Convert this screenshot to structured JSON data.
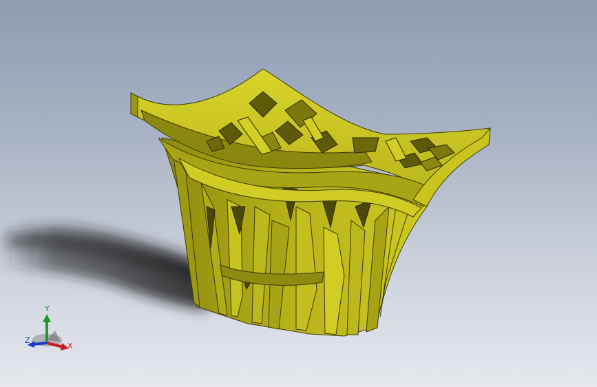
{
  "viewport": {
    "background_top": "#8d9cb2",
    "background_bottom": "#e6e8ee",
    "model_color": "#c9c41a",
    "model_shade": "#a7a214",
    "model_dark": "#6e6b0c"
  },
  "triad": {
    "x_label": "X",
    "y_label": "Y",
    "z_label": "Z",
    "x_color": "#c81e1e",
    "y_color": "#1e9a32",
    "z_color": "#1e3cc8"
  }
}
